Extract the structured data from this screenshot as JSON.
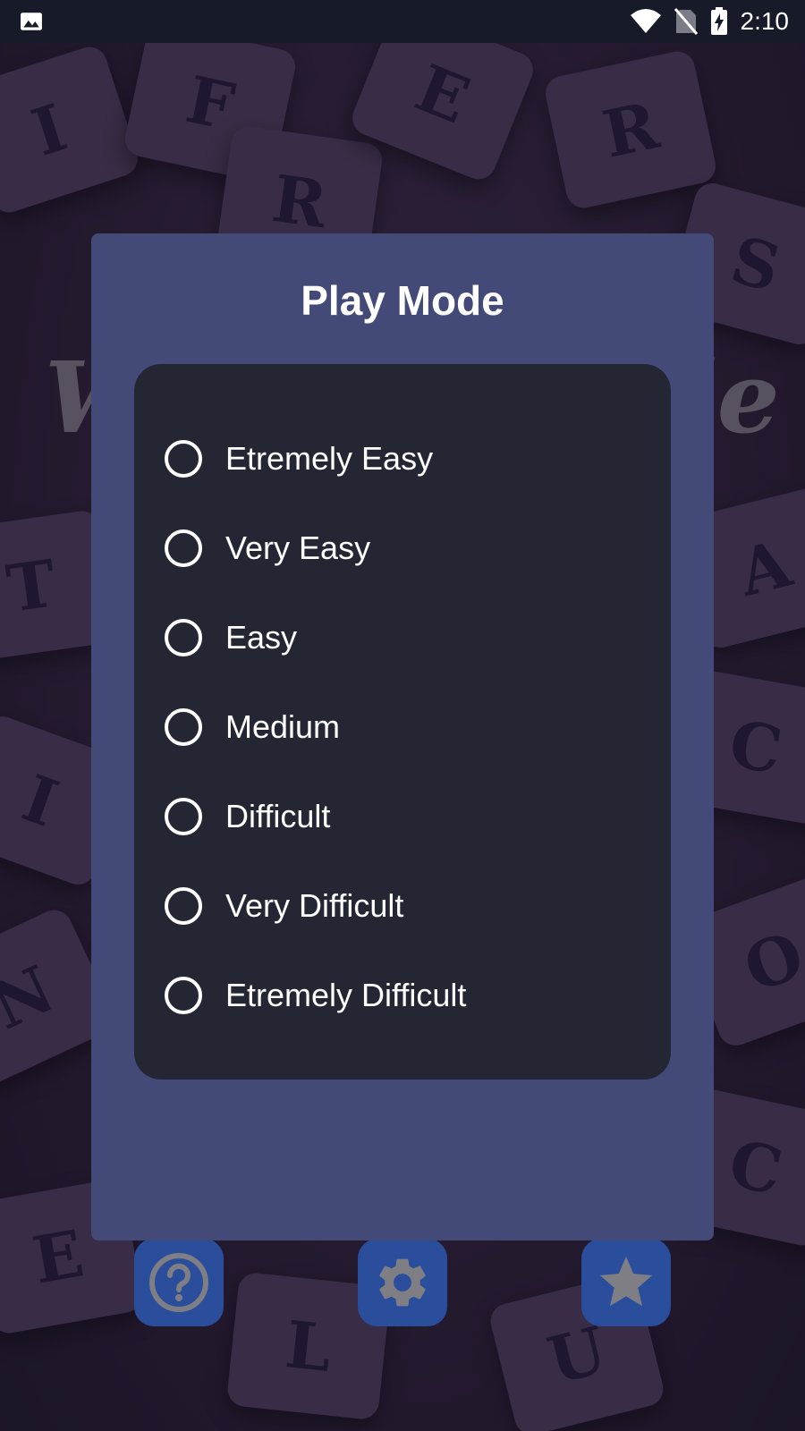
{
  "status_bar": {
    "time": "2:10",
    "icons": [
      "image-icon",
      "wifi-icon",
      "no-sim-icon",
      "battery-charging-icon"
    ]
  },
  "dialog": {
    "title": "Play Mode",
    "options": [
      {
        "label": "Etremely Easy",
        "selected": false
      },
      {
        "label": "Very Easy",
        "selected": false
      },
      {
        "label": "Easy",
        "selected": false
      },
      {
        "label": "Medium",
        "selected": false
      },
      {
        "label": "Difficult",
        "selected": false
      },
      {
        "label": "Very Difficult",
        "selected": false
      },
      {
        "label": "Etremely Difficult",
        "selected": false
      }
    ]
  },
  "bottom_bar": {
    "buttons": [
      {
        "icon": "help-icon"
      },
      {
        "icon": "settings-icon"
      },
      {
        "icon": "star-icon"
      }
    ]
  },
  "colors": {
    "status_bar_bg": "#171a28",
    "dialog_bg": "#434a78",
    "options_panel_bg": "#242634",
    "button_bg": "#2a4e9b",
    "text": "#ffffff"
  }
}
